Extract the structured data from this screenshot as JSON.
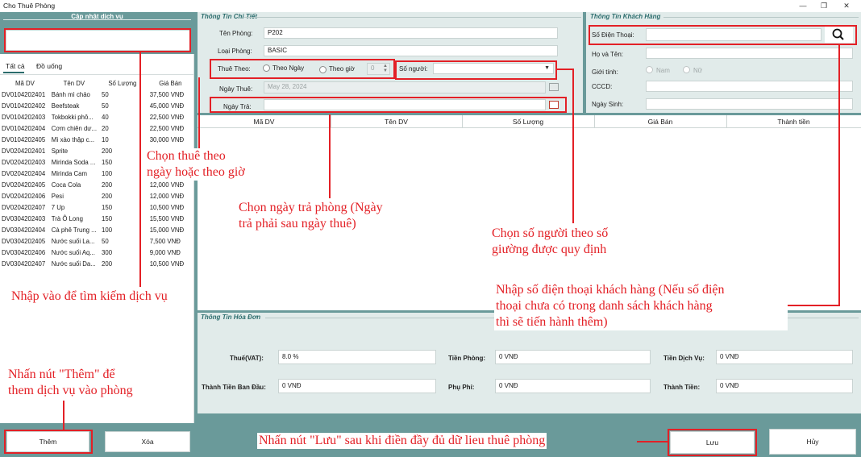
{
  "window": {
    "title": "Cho Thuê Phòng",
    "minimize": "—",
    "maximize": "❐",
    "close": "✕"
  },
  "left": {
    "section_title": "Cập nhật dịch vụ",
    "search_value": "",
    "tabs": [
      "Tất cả",
      "Đồ uống"
    ],
    "columns": [
      "Mã DV",
      "Tên DV",
      "Số Lượng",
      "Giá Bán"
    ],
    "rows": [
      [
        "DV0104202401",
        "Bánh mì chảo",
        "50",
        "37,500 VNĐ"
      ],
      [
        "DV0104202402",
        "Beefsteak",
        "50",
        "45,000 VNĐ"
      ],
      [
        "DV0104202403",
        "Tokbokki phô...",
        "40",
        "22,500 VNĐ"
      ],
      [
        "DV0104202404",
        "Cơm chiên dư...",
        "20",
        "22,500 VNĐ"
      ],
      [
        "DV0104202405",
        "Mì xào thập c...",
        "10",
        "30,000 VNĐ"
      ],
      [
        "DV0204202401",
        "Sprite",
        "200",
        "10,500 VNĐ"
      ],
      [
        "DV0204202403",
        "Mirinda Soda ...",
        "150",
        "10,500 VNĐ"
      ],
      [
        "DV0204202404",
        "Mirinda Cam",
        "100",
        "10,500 VNĐ"
      ],
      [
        "DV0204202405",
        "Coca Cola",
        "200",
        "12,000 VNĐ"
      ],
      [
        "DV0204202406",
        "Pesi",
        "200",
        "12,000 VNĐ"
      ],
      [
        "DV0204202407",
        "7 Up",
        "150",
        "10,500 VNĐ"
      ],
      [
        "DV0304202403",
        "Trà Ô Long",
        "150",
        "15,500 VNĐ"
      ],
      [
        "DV0304202404",
        "Cà phê Trung ...",
        "100",
        "15,000 VNĐ"
      ],
      [
        "DV0304202405",
        "Nước suối La...",
        "50",
        "7,500 VNĐ"
      ],
      [
        "DV0304202406",
        "Nước suối Aq...",
        "300",
        "9,000 VNĐ"
      ],
      [
        "DV0304202407",
        "Nước suối Da...",
        "200",
        "10,500 VNĐ"
      ]
    ],
    "add_button": "Thêm",
    "delete_button": "Xóa"
  },
  "detail": {
    "section_title": "Thông Tin Chi Tiết",
    "room_name_label": "Tên Phòng:",
    "room_name": "P202",
    "room_type_label": "Loại Phòng:",
    "room_type": "BASIC",
    "rent_by_label": "Thuê Theo:",
    "by_day": "Theo Ngày",
    "by_hour": "Theo giờ",
    "hour_value": "0",
    "people_label": "Số người:",
    "rent_date_label": "Ngày Thuê:",
    "rent_date": "May 28, 2024",
    "return_date_label": "Ngày Trả:",
    "return_date": "",
    "columns": [
      "Mã DV",
      "Tên DV",
      "Số Lượng",
      "Giá Bán",
      "Thành tiền"
    ]
  },
  "customer": {
    "section_title": "Thông Tin Khách Hàng",
    "phone_label": "Số Điện Thoại:",
    "name_label": "Họ và Tên:",
    "gender_label": "Giới tính:",
    "male": "Nam",
    "female": "Nữ",
    "id_label": "CCCD:",
    "birth_label": "Ngày Sinh:"
  },
  "invoice": {
    "section_title": "Thông Tin Hóa Đơn",
    "vat_label": "Thuế(VAT):",
    "vat": "8.0 %",
    "room_fee_label": "Tiền Phòng:",
    "room_fee": "0 VNĐ",
    "service_fee_label": "Tiền Dịch Vụ:",
    "service_fee": "0 VNĐ",
    "initial_label": "Thành Tiền Ban Đầu:",
    "initial": "0 VNĐ",
    "surcharge_label": "Phụ Phí:",
    "surcharge": "0 VNĐ",
    "total_label": "Thành Tiền:",
    "total": "0 VNĐ"
  },
  "actions": {
    "save": "Lưu",
    "cancel": "Hủy"
  },
  "annotations": {
    "rent_type": "Chọn thuê theo\nngày hoặc theo giờ",
    "return_date": "Chọn ngày trả phòng (Ngày\ntrả phải sau ngày thuê)",
    "people": "Chọn số người theo số\ngiường được quy định",
    "phone": "Nhập số điện thoại khách hàng (Nếu số điện\nthoại chưa có trong danh sách khách hàng\nthì sẽ tiến hành thêm)",
    "search": "Nhập vào để tìm kiếm dịch vụ",
    "add": "Nhấn nút \"Thêm\" để\nthem dịch vụ vào phòng",
    "save": "Nhấn nút \"Lưu\" sau khi điền đầy đủ dữ lieu thuê phòng"
  },
  "colors": {
    "teal": "#6a9a9a",
    "panel": "#e1ebea",
    "annotation": "#e32026"
  }
}
